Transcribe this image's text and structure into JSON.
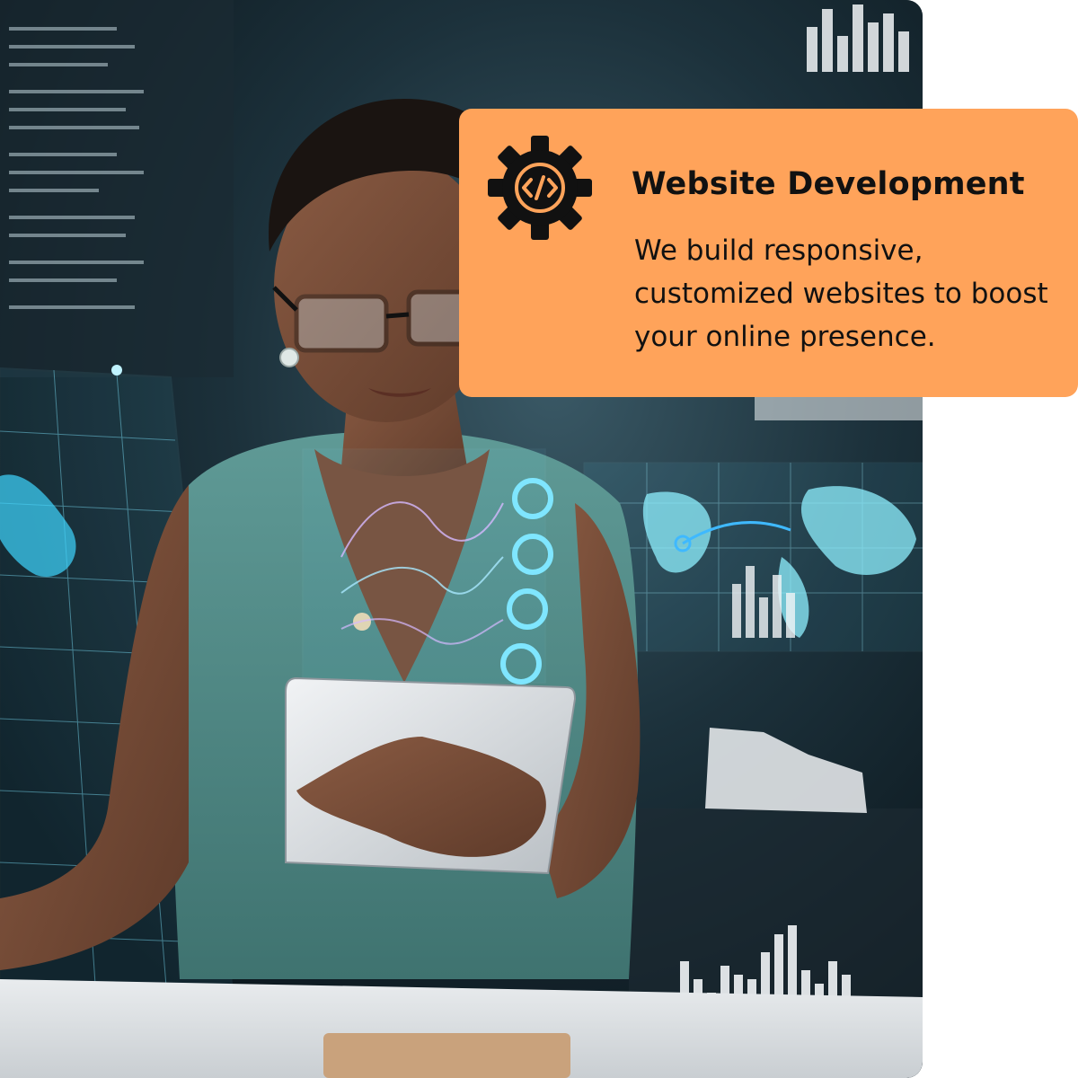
{
  "service_card": {
    "title": "Website Development",
    "description": "We build responsive, customized websites to boost your online presence.",
    "icon": "gear-code-icon",
    "background_color": "#ffa35a",
    "text_color": "#111111"
  },
  "photo": {
    "subject": "woman-with-tablet-photo"
  }
}
